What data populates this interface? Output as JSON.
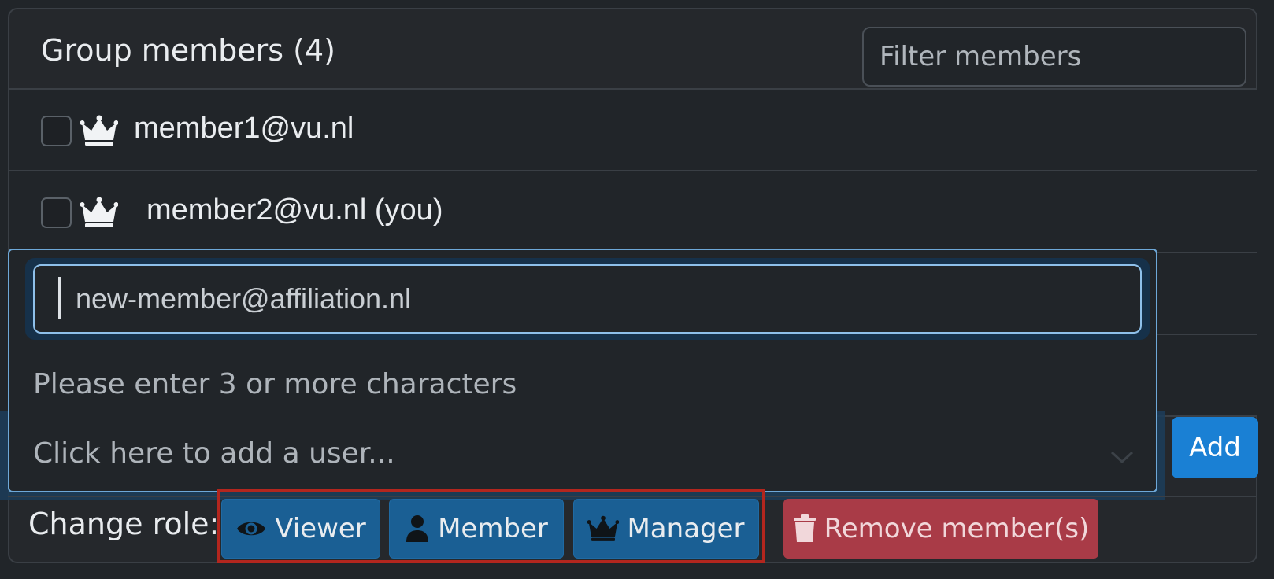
{
  "header": {
    "title": "Group members (4)",
    "filter_placeholder": "Filter members"
  },
  "members": [
    {
      "email": "member1@vu.nl",
      "role_icon": "crown-icon"
    },
    {
      "email": "member2@vu.nl (you)",
      "role_icon": "crown-icon"
    }
  ],
  "add_user": {
    "input_value": "new-member@affiliation.nl",
    "hint": "Please enter 3 or more characters",
    "select_placeholder": "Click here to add a user...",
    "add_label": "Add"
  },
  "footer": {
    "change_role_label": "Change role:",
    "viewer_label": "Viewer",
    "member_label": "Member",
    "manager_label": "Manager",
    "remove_label": "Remove member(s)"
  },
  "colors": {
    "background": "#212529",
    "primary": "#1a80d4",
    "role_button": "#1a5f94",
    "danger": "#a93b47",
    "highlight_outline": "#b3261e"
  }
}
